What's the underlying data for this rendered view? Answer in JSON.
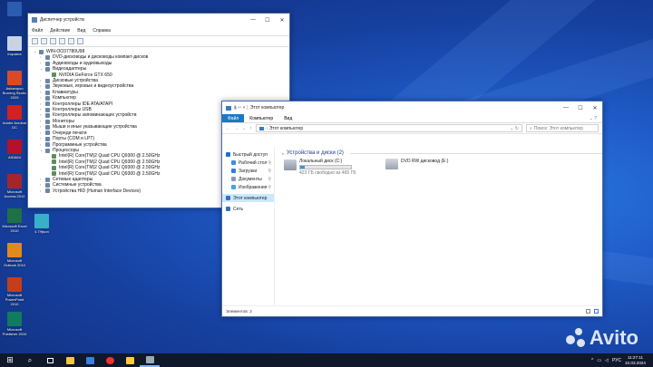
{
  "desktop_icons": [
    {
      "label": "",
      "color": "#2a5db0"
    },
    {
      "label": "Корзина",
      "color": "#c9d4e3"
    },
    {
      "label": "Ashampoo Burning Studio 2025",
      "color": "#d94b28"
    },
    {
      "label": "Adobe Acrobat DC",
      "color": "#d32020"
    },
    {
      "label": "AIDA64",
      "color": "#b8102a"
    },
    {
      "label": "Microsoft Access 2010",
      "color": "#a4262c"
    },
    {
      "label": "Microsoft Excel 2010",
      "color": "#1e7145"
    },
    {
      "label": "Microsoft Outlook 2010",
      "color": "#e08a1c"
    },
    {
      "label": "Microsoft PowerPoint 2010",
      "color": "#c43e1c"
    },
    {
      "label": "Microsoft Publisher 2010",
      "color": "#0f7b5f"
    }
  ],
  "extra_icon": {
    "label": "4.7Hjson"
  },
  "device_manager": {
    "title": "Диспетчер устройств",
    "menu": [
      "Файл",
      "Действие",
      "Вид",
      "Справка"
    ],
    "tree": [
      {
        "t": "WIN-OO37780U98",
        "level": 0,
        "arrow": "v"
      },
      {
        "t": "DVD-дисководы и дисководы компакт-дисков",
        "level": 1,
        "arrow": ">"
      },
      {
        "t": "Аудиовходы и аудиовыходы",
        "level": 1,
        "arrow": ">"
      },
      {
        "t": "Видеоадаптеры",
        "level": 1,
        "arrow": "v"
      },
      {
        "t": "NVIDIA GeForce GTX 650",
        "level": 2,
        "arrow": ""
      },
      {
        "t": "Дисковые устройства",
        "level": 1,
        "arrow": ">"
      },
      {
        "t": "Звуковые, игровые и видеоустройства",
        "level": 1,
        "arrow": ">"
      },
      {
        "t": "Клавиатуры",
        "level": 1,
        "arrow": ">"
      },
      {
        "t": "Компьютер",
        "level": 1,
        "arrow": ">"
      },
      {
        "t": "Контроллеры IDE ATA/ATAPI",
        "level": 1,
        "arrow": ">"
      },
      {
        "t": "Контроллеры USB",
        "level": 1,
        "arrow": ">"
      },
      {
        "t": "Контроллеры запоминающих устройств",
        "level": 1,
        "arrow": ">"
      },
      {
        "t": "Мониторы",
        "level": 1,
        "arrow": ">"
      },
      {
        "t": "Мыши и иные указывающие устройства",
        "level": 1,
        "arrow": ">"
      },
      {
        "t": "Очереди печати",
        "level": 1,
        "arrow": ">"
      },
      {
        "t": "Порты (COM и LPT)",
        "level": 1,
        "arrow": ">"
      },
      {
        "t": "Программные устройства",
        "level": 1,
        "arrow": ">"
      },
      {
        "t": "Процессоры",
        "level": 1,
        "arrow": "v"
      },
      {
        "t": "Intel(R) Core(TM)2 Quad  CPU   Q9300  @ 2.50GHz",
        "level": 2,
        "arrow": ""
      },
      {
        "t": "Intel(R) Core(TM)2 Quad  CPU   Q9300  @ 2.50GHz",
        "level": 2,
        "arrow": ""
      },
      {
        "t": "Intel(R) Core(TM)2 Quad  CPU   Q9300  @ 2.50GHz",
        "level": 2,
        "arrow": ""
      },
      {
        "t": "Intel(R) Core(TM)2 Quad  CPU   Q9300  @ 2.50GHz",
        "level": 2,
        "arrow": ""
      },
      {
        "t": "Сетевые адаптеры",
        "level": 1,
        "arrow": ">"
      },
      {
        "t": "Системные устройства",
        "level": 1,
        "arrow": ">"
      },
      {
        "t": "Устройства HID (Human Interface Devices)",
        "level": 1,
        "arrow": ">"
      }
    ]
  },
  "explorer": {
    "title": "Этот компьютер",
    "ribbon": [
      "Файл",
      "Компьютер",
      "Вид"
    ],
    "address": "Этот компьютер",
    "search_placeholder": "Поиск: Этот компьютер",
    "nav": [
      {
        "label": "Быстрый доступ",
        "color": "#1e6fd1",
        "pin": false
      },
      {
        "label": "Рабочий стол",
        "color": "#3a8ee6",
        "pin": true
      },
      {
        "label": "Загрузки",
        "color": "#2f7fd8",
        "pin": true
      },
      {
        "label": "Документы",
        "color": "#8a9bb0",
        "pin": true
      },
      {
        "label": "Изображения",
        "color": "#4aa3e0",
        "pin": true
      },
      {
        "label": "Этот компьютер",
        "color": "#3b6fb5",
        "pin": false
      },
      {
        "label": "Сеть",
        "color": "#3b6fb5",
        "pin": false
      }
    ],
    "section_title": "Устройства и диски (2)",
    "drive_c": {
      "name": "Локальный диск (C:)",
      "free": "423 ГБ свободно из 465 ГБ",
      "used_fraction": 0.09
    },
    "drive_e": {
      "name": "DVD RW дисковод (E:)"
    },
    "status": "Элементов: 2"
  },
  "taskbar": {
    "time": "11:27:11",
    "date": "10.03.2024"
  },
  "watermark": "Avito"
}
